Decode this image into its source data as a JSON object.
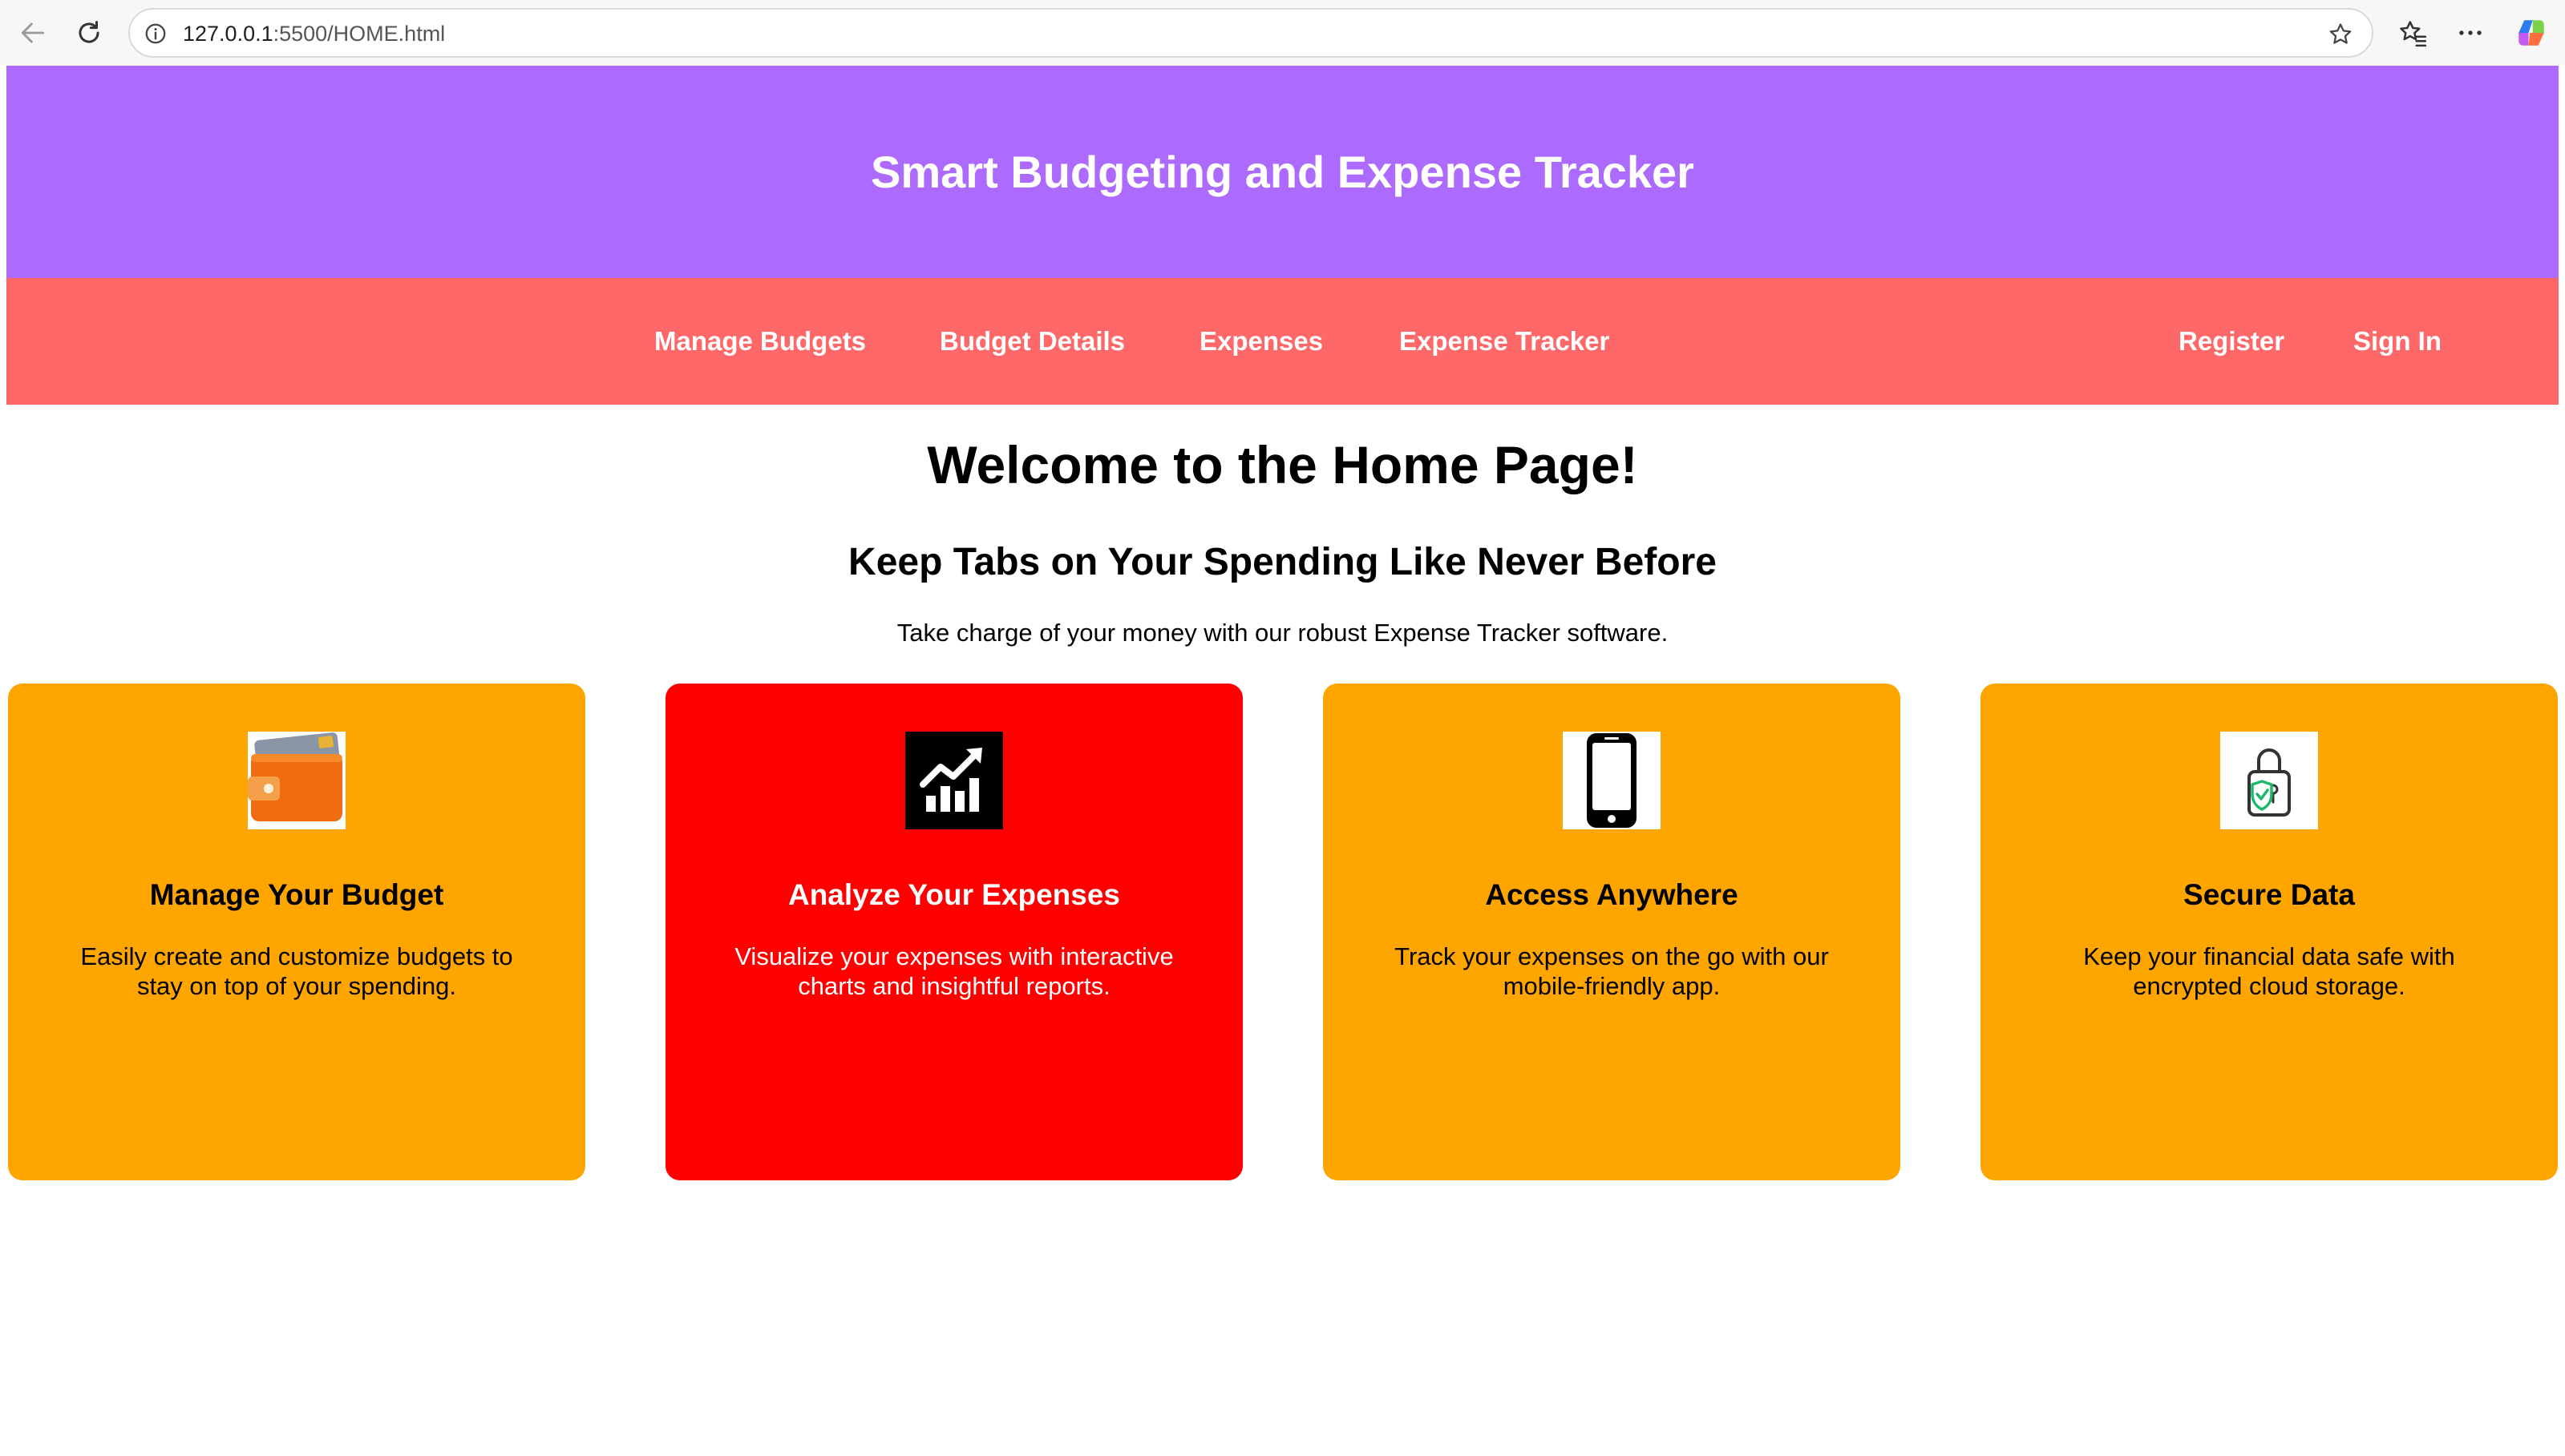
{
  "browser": {
    "url_host": "127.0.0.1",
    "url_rest": ":5500/HOME.html"
  },
  "header": {
    "title": "Smart Budgeting and Expense Tracker"
  },
  "nav": {
    "links": [
      {
        "label": "Manage Budgets"
      },
      {
        "label": "Budget Details"
      },
      {
        "label": "Expenses"
      },
      {
        "label": "Expense Tracker"
      }
    ],
    "auth": [
      {
        "label": "Register"
      },
      {
        "label": "Sign In"
      }
    ]
  },
  "main": {
    "heading": "Welcome to the Home Page!",
    "subheading": "Keep Tabs on Your Spending Like Never Before",
    "tagline": "Take charge of your money with our robust Expense Tracker software."
  },
  "features": [
    {
      "title": "Manage Your Budget",
      "text": "Easily create and customize budgets to stay on top of your spending.",
      "color": "#ffa500",
      "icon": "wallet-icon"
    },
    {
      "title": "Analyze Your Expenses",
      "text": "Visualize your expenses with interactive charts and insightful reports.",
      "color": "#ff0000",
      "icon": "chart-icon"
    },
    {
      "title": "Access Anywhere",
      "text": "Track your expenses on the go with our mobile-friendly app.",
      "color": "#ffa500",
      "icon": "smartphone-icon"
    },
    {
      "title": "Secure Data",
      "text": "Keep your financial data safe with encrypted cloud storage.",
      "color": "#ffa500",
      "icon": "padlock-icon"
    }
  ],
  "colors": {
    "header_bg": "#ac6aff",
    "nav_bg": "#ff6868",
    "card_orange": "#ffa500",
    "card_red": "#ff0000"
  }
}
